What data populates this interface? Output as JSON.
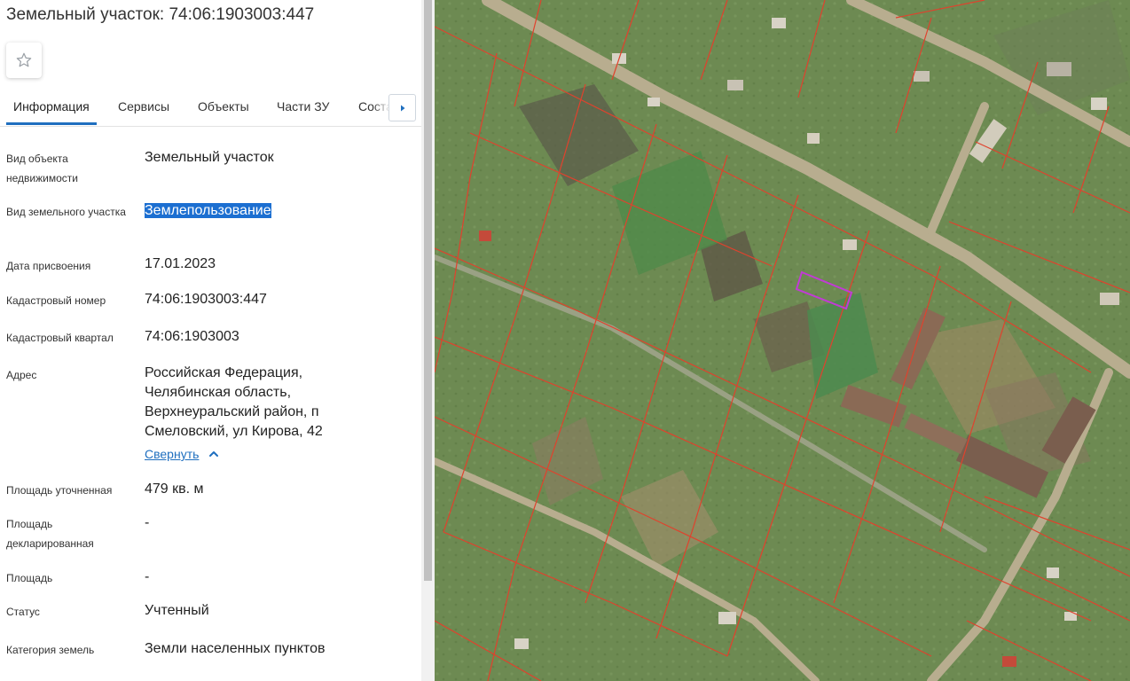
{
  "title": "Земельный участок: 74:06:1903003:447",
  "favorite_icon": "star-outline-icon",
  "tabs": [
    "Информация",
    "Сервисы",
    "Объекты",
    "Части ЗУ",
    "Соста"
  ],
  "tab_next_icon": "triangle-right-icon",
  "rows": [
    {
      "label": "Вид объекта недвижимости",
      "value": "Земельный участок"
    },
    {
      "label": "Вид земельного участка",
      "value": "Землепользование"
    },
    {
      "label": "Дата присвоения",
      "value": "17.01.2023"
    },
    {
      "label": "Кадастровый номер",
      "value": "74:06:1903003:447"
    },
    {
      "label": "Кадастровый квартал",
      "value": "74:06:1903003"
    },
    {
      "label": "Адрес",
      "value": "Российская Федерация, Челябинская область, Верхнеуральский район, п Смеловский, ул Кирова, 42"
    },
    {
      "label": "Площадь уточненная",
      "value": "479 кв. м"
    },
    {
      "label": "Площадь декларированная",
      "value": "-"
    },
    {
      "label": "Площадь",
      "value": "-"
    },
    {
      "label": "Статус",
      "value": "Учтенный"
    },
    {
      "label": "Категория земель",
      "value": "Земли населенных пунктов"
    }
  ],
  "collapse_link": "Свернуть",
  "colors": {
    "accent": "#1f6fbf",
    "selection": "#1c6fd1",
    "parcel_border": "#e0422d",
    "highlight_parcel": "#c23ad6"
  }
}
